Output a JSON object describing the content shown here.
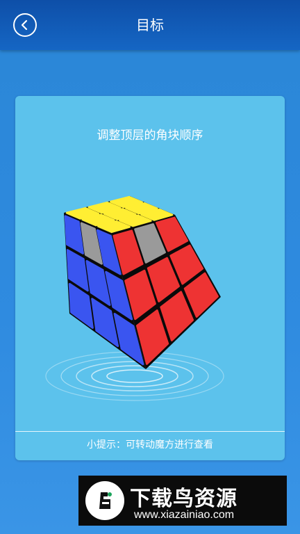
{
  "header": {
    "title": "目标",
    "back_icon": "chevron-left-icon"
  },
  "card": {
    "title": "调整顶层的角块顺序",
    "hint": "小提示：可转动魔方进行查看"
  },
  "cube": {
    "colors": {
      "yellow": "#ffee33",
      "gray": "#9a9a9a",
      "blue": "#3a55f0",
      "red": "#ee3333",
      "frame": "#0a0a0a"
    },
    "faces": {
      "top": [
        "yellow",
        "yellow",
        "yellow",
        "yellow",
        "yellow",
        "yellow",
        "yellow",
        "yellow",
        "yellow"
      ],
      "left": [
        "blue",
        "gray",
        "blue",
        "blue",
        "blue",
        "blue",
        "blue",
        "blue",
        "blue"
      ],
      "right": [
        "red",
        "gray",
        "red",
        "red",
        "red",
        "red",
        "red",
        "red",
        "red"
      ]
    }
  },
  "watermark": {
    "brand": "下载鸟资源",
    "url": "www.xiazainiao.com"
  },
  "theme": {
    "header_bg": "#1161bc",
    "page_bg": "#2f8be0",
    "card_bg": "#5cc2ec"
  }
}
